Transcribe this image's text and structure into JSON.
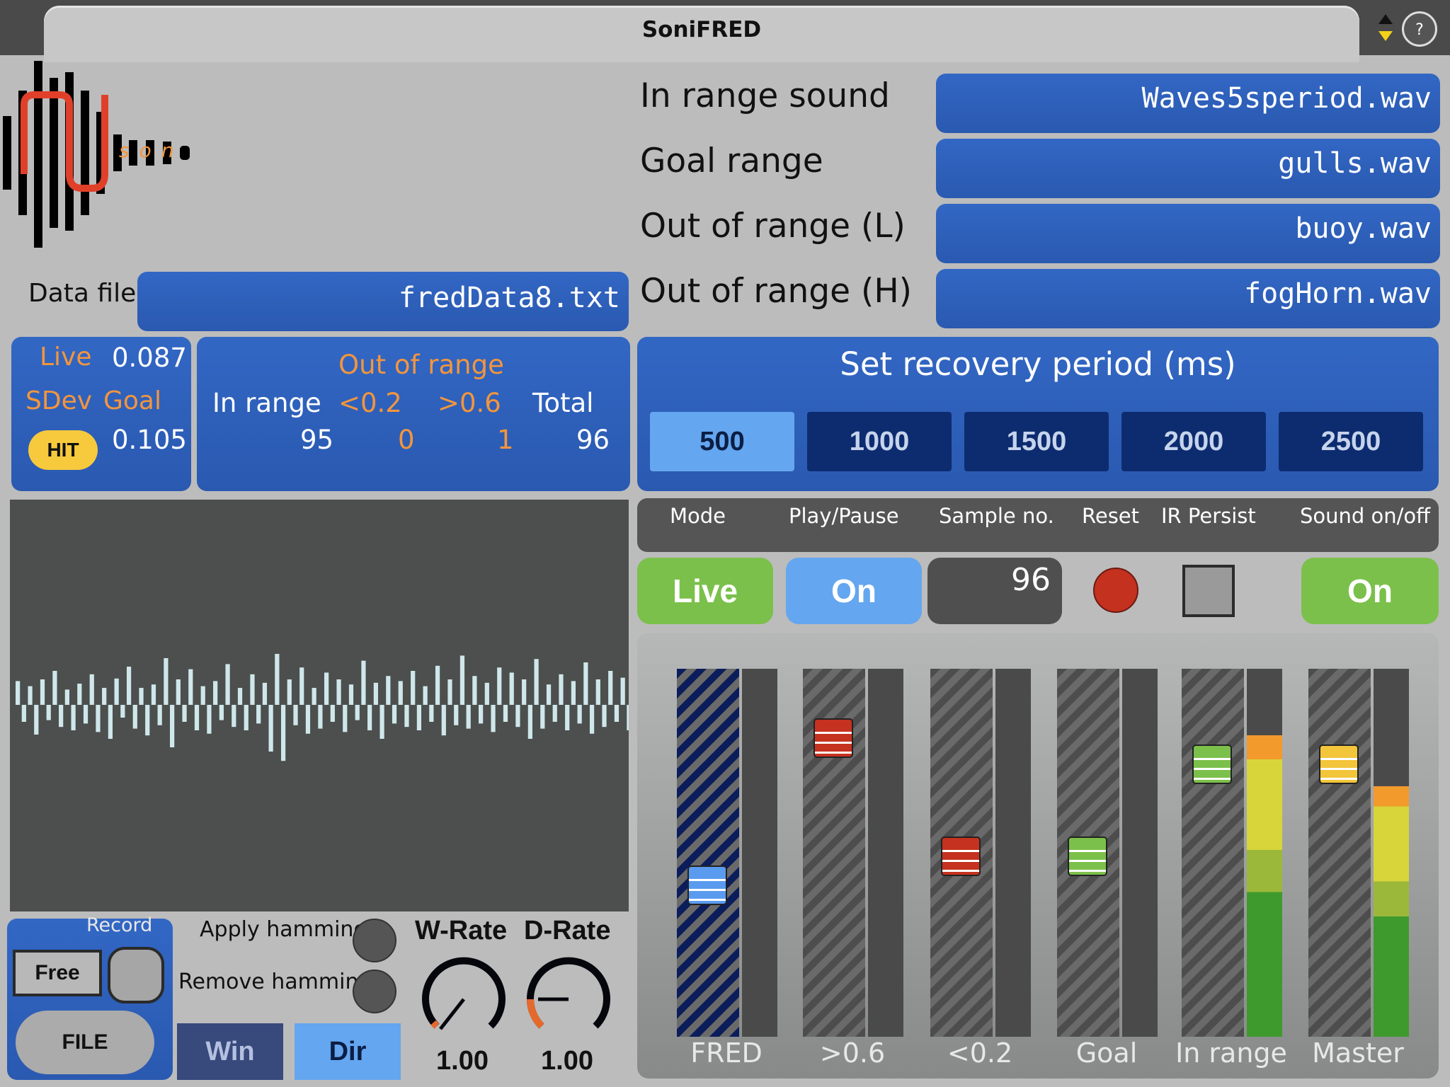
{
  "app": {
    "title": "SoniFRED"
  },
  "logo": {
    "text": "son"
  },
  "data_file": {
    "label": "Data file",
    "value": "fredData8.txt"
  },
  "sounds": [
    {
      "label": "In range sound",
      "file": "Waves5speriod.wav"
    },
    {
      "label": "Goal range",
      "file": "gulls.wav"
    },
    {
      "label": "Out of range (L)",
      "file": "buoy.wav"
    },
    {
      "label": "Out of range (H)",
      "file": "fogHorn.wav"
    }
  ],
  "stats": {
    "live_label": "Live",
    "live_value": "0.087",
    "sdev_label": "SDev",
    "goal_label": "Goal",
    "hit_label": "HIT",
    "goal_value": "0.105"
  },
  "counts": {
    "header": "Out of range",
    "in_range_label": "In range",
    "low_label": "<0.2",
    "high_label": ">0.6",
    "total_label": "Total",
    "in_range": "95",
    "low": "0",
    "high": "1",
    "total": "96"
  },
  "recovery": {
    "title": "Set recovery period (ms)",
    "options": [
      "500",
      "1000",
      "1500",
      "2000",
      "2500"
    ],
    "selected": "500"
  },
  "controls": {
    "headers": [
      "Mode",
      "Play/Pause",
      "Sample no.",
      "Reset",
      "IR Persist",
      "Sound on/off"
    ],
    "mode": "Live",
    "play": "On",
    "sample_no": "96",
    "sound": "On"
  },
  "record": {
    "label": "Record",
    "free": "Free",
    "file": "FILE",
    "apply_hamming": "Apply hamming",
    "remove_hamming": "Remove hamming",
    "win": "Win",
    "dir": "Dir"
  },
  "rates": {
    "w_label": "W-Rate",
    "d_label": "D-Rate",
    "w_value": "1.00",
    "d_value": "1.00"
  },
  "faders": [
    {
      "label": "FRED",
      "color": "#5a9bef",
      "level": 0.4
    },
    {
      "label": ">0.6",
      "color": "#c5321f",
      "level": 0.85
    },
    {
      "label": "<0.2",
      "color": "#c5321f",
      "level": 0.49
    },
    {
      "label": "Goal",
      "color": "#7bc04b",
      "level": 0.49
    },
    {
      "label": "In range",
      "color": "#7bc04b",
      "level": 0.77,
      "meter": 0.82
    },
    {
      "label": "Master",
      "color": "#f3c53a",
      "level": 0.77,
      "meter": 0.68
    }
  ],
  "colors": {
    "panel_blue": "#2b5cb6",
    "accent_orange": "#f3953d",
    "green": "#7bc04b",
    "light_blue": "#64a6ef"
  },
  "waveform": {
    "values": [
      0.28,
      -0.2,
      0.22,
      -0.35,
      0.3,
      -0.18,
      0.4,
      -0.26,
      0.18,
      -0.3,
      0.25,
      -0.22,
      0.36,
      -0.32,
      0.2,
      -0.4,
      0.31,
      -0.15,
      0.45,
      -0.28,
      0.2,
      -0.36,
      0.24,
      -0.24,
      0.55,
      -0.5,
      0.3,
      -0.2,
      0.42,
      -0.3,
      0.22,
      -0.34,
      0.28,
      -0.18,
      0.48,
      -0.26,
      0.2,
      -0.3,
      0.36,
      -0.22,
      0.26,
      -0.55,
      0.6,
      -0.66,
      0.3,
      -0.24,
      0.44,
      -0.34,
      0.2,
      -0.28,
      0.38,
      -0.2,
      0.3,
      -0.32,
      0.24,
      -0.18,
      0.52,
      -0.3,
      0.26,
      -0.4,
      0.34,
      -0.22,
      0.28,
      -0.26,
      0.4,
      -0.3,
      0.22,
      -0.2,
      0.46,
      -0.36,
      0.3,
      -0.24,
      0.58,
      -0.28,
      0.34,
      -0.22,
      0.26,
      -0.32,
      0.44,
      -0.2,
      0.38,
      -0.26,
      0.3,
      -0.4,
      0.54,
      -0.28,
      0.24,
      -0.2,
      0.36,
      -0.3,
      0.28,
      -0.22,
      0.5,
      -0.34,
      0.3,
      -0.26,
      0.4,
      -0.2,
      0.32,
      -0.3
    ]
  }
}
